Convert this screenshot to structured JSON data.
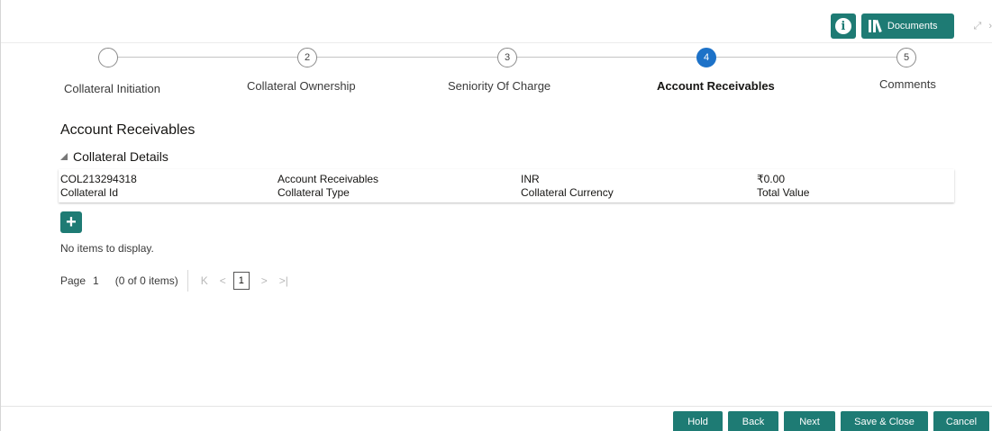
{
  "header": {
    "documents_label": "Documents",
    "window_controls": [
      "⤢",
      "›"
    ]
  },
  "stepper": {
    "steps": [
      {
        "number": "",
        "label": "Collateral Initiation",
        "state": "completed"
      },
      {
        "number": "2",
        "label": "Collateral Ownership",
        "state": "pending"
      },
      {
        "number": "3",
        "label": "Seniority Of Charge",
        "state": "pending"
      },
      {
        "number": "4",
        "label": "Account Receivables",
        "state": "active"
      },
      {
        "number": "5",
        "label": "Comments",
        "state": "pending"
      }
    ]
  },
  "section": {
    "title": "Account Receivables",
    "panel_title": "Collateral Details"
  },
  "collateral_details": [
    {
      "value": "COL213294318",
      "label": "Collateral Id"
    },
    {
      "value": "Account Receivables",
      "label": "Collateral Type"
    },
    {
      "value": "INR",
      "label": "Collateral Currency"
    },
    {
      "value": "₹0.00",
      "label": "Total Value"
    }
  ],
  "table": {
    "add_glyph": "+",
    "empty_message": "No items to display."
  },
  "pagination": {
    "page_label": "Page",
    "page_number": "1",
    "item_count": "(0 of 0 items)",
    "first_glyph": "K",
    "prev_glyph": "<",
    "current": "1",
    "next_glyph": ">",
    "last_glyph": ">|"
  },
  "footer": {
    "hold": "Hold",
    "back": "Back",
    "next": "Next",
    "save_close": "Save & Close",
    "cancel": "Cancel"
  },
  "colors": {
    "primary": "#1e7b74",
    "active_step": "#1d72c8"
  }
}
